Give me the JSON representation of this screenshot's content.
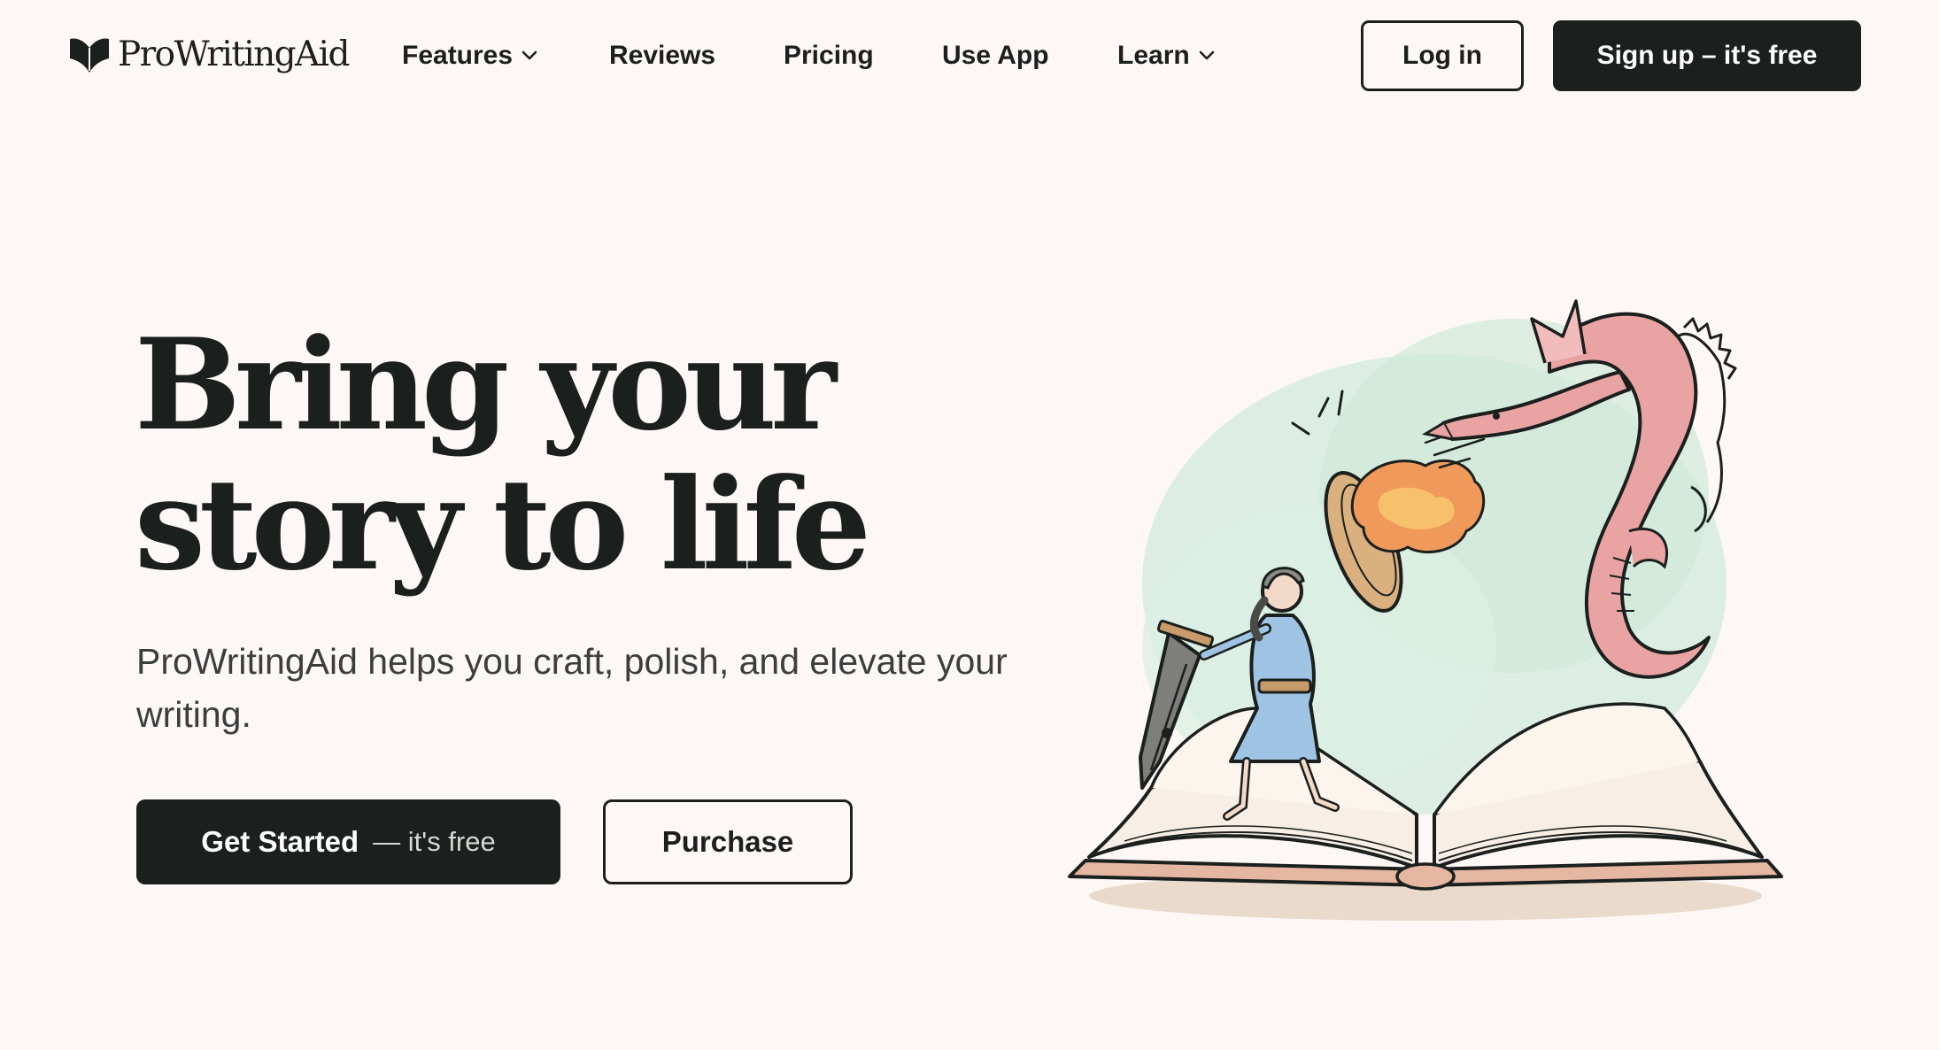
{
  "brand": {
    "name": "ProWritingAid",
    "logo_icon": "book-heart-logo-icon"
  },
  "nav": {
    "items": [
      {
        "label": "Features",
        "has_dropdown": true
      },
      {
        "label": "Reviews",
        "has_dropdown": false
      },
      {
        "label": "Pricing",
        "has_dropdown": false
      },
      {
        "label": "Use App",
        "has_dropdown": false
      },
      {
        "label": "Learn",
        "has_dropdown": true
      }
    ],
    "login_label": "Log in",
    "signup_label": "Sign up – it's free"
  },
  "hero": {
    "title_line1": "Bring your",
    "title_line2": "story to life",
    "subtitle": "ProWritingAid helps you craft, polish, and elevate your writing.",
    "primary_cta": {
      "label": "Get Started",
      "suffix": "— it's free"
    },
    "secondary_cta": {
      "label": "Purchase"
    },
    "illustration": "knight-fighting-dragon-on-open-book-illustration"
  },
  "colors": {
    "background": "#fdf8f5",
    "text": "#1b1f1e",
    "button_dark": "#1b1f1e",
    "dragon_pink": "#e9a3a3",
    "knight_blue": "#9fc3e3",
    "mint_wash": "#cfe8d8"
  }
}
